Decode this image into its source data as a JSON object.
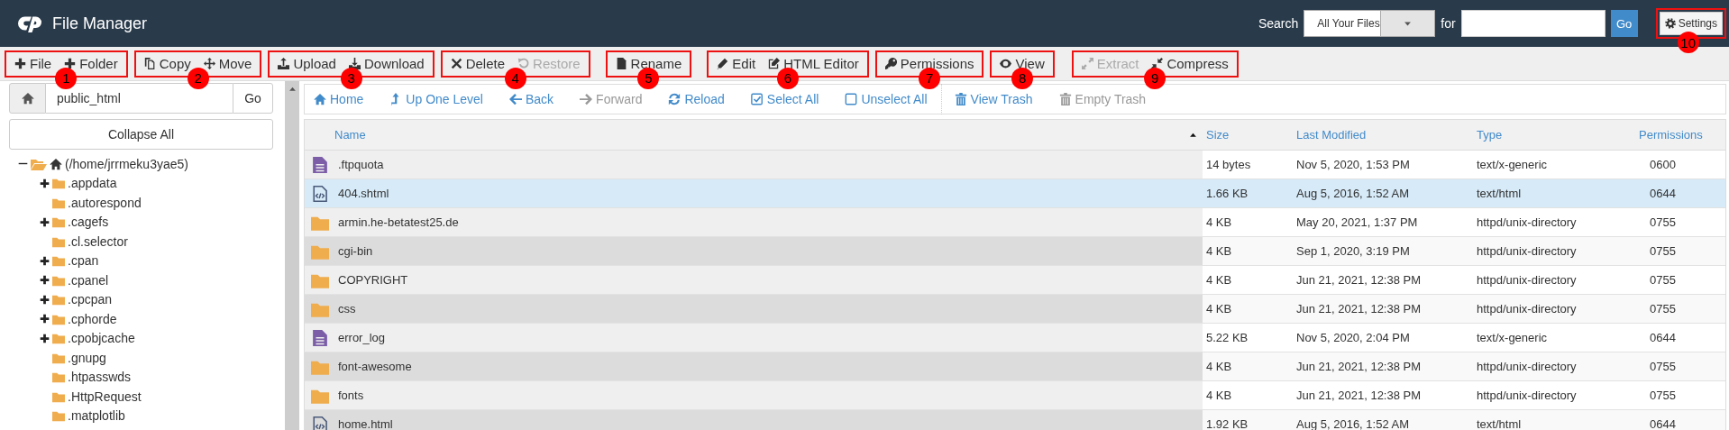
{
  "header": {
    "title": "File Manager",
    "search_label": "Search",
    "scope": "All Your Files",
    "for_label": "for",
    "go": "Go",
    "settings": {
      "label": "Settings",
      "callout": "10"
    }
  },
  "toolbar": [
    {
      "callout": "1",
      "buttons": [
        {
          "label": "File",
          "disabled": false
        },
        {
          "label": "Folder",
          "disabled": false
        }
      ]
    },
    {
      "callout": "2",
      "buttons": [
        {
          "label": "Copy",
          "disabled": false
        },
        {
          "label": "Move",
          "disabled": false
        }
      ]
    },
    {
      "callout": "3",
      "buttons": [
        {
          "label": "Upload",
          "disabled": false
        },
        {
          "label": "Download",
          "disabled": false
        }
      ]
    },
    {
      "callout": "4",
      "buttons": [
        {
          "label": "Delete",
          "disabled": false
        },
        {
          "label": "Restore",
          "disabled": true
        }
      ]
    },
    {
      "callout": "5",
      "buttons": [
        {
          "label": "Rename",
          "disabled": false
        }
      ]
    },
    {
      "callout": "6",
      "buttons": [
        {
          "label": "Edit",
          "disabled": false
        },
        {
          "label": "HTML Editor",
          "disabled": false
        }
      ]
    },
    {
      "callout": "7",
      "buttons": [
        {
          "label": "Permissions",
          "disabled": false
        }
      ]
    },
    {
      "callout": "8",
      "buttons": [
        {
          "label": "View",
          "disabled": false
        }
      ]
    },
    {
      "callout": "9",
      "buttons": [
        {
          "label": "Extract",
          "disabled": true
        },
        {
          "label": "Compress",
          "disabled": false
        }
      ]
    }
  ],
  "sidebar": {
    "path": "public_html",
    "go": "Go",
    "collapse": "Collapse All",
    "tree": {
      "label": "(/home/jrrmeku3yae5)",
      "kind": "branch",
      "expanded": true,
      "children": [
        {
          "label": ".appdata",
          "kind": "branch",
          "expanded": false
        },
        {
          "label": ".autorespond",
          "kind": "leaf"
        },
        {
          "label": ".cagefs",
          "kind": "branch",
          "expanded": false
        },
        {
          "label": ".cl.selector",
          "kind": "leaf"
        },
        {
          "label": ".cpan",
          "kind": "branch",
          "expanded": false
        },
        {
          "label": ".cpanel",
          "kind": "branch",
          "expanded": false
        },
        {
          "label": ".cpcpan",
          "kind": "branch",
          "expanded": false
        },
        {
          "label": ".cphorde",
          "kind": "branch",
          "expanded": false
        },
        {
          "label": ".cpobjcache",
          "kind": "branch",
          "expanded": false
        },
        {
          "label": ".gnupg",
          "kind": "leaf"
        },
        {
          "label": ".htpasswds",
          "kind": "leaf"
        },
        {
          "label": ".HttpRequest",
          "kind": "leaf"
        },
        {
          "label": ".matplotlib",
          "kind": "leaf"
        }
      ]
    }
  },
  "nav": [
    {
      "label": "Home",
      "disabled": false
    },
    {
      "label": "Up One Level",
      "disabled": false
    },
    {
      "label": "Back",
      "disabled": false
    },
    {
      "label": "Forward",
      "disabled": true
    },
    {
      "label": "Reload",
      "disabled": false
    },
    {
      "label": "Select All",
      "disabled": false
    },
    {
      "label": "Unselect All",
      "disabled": false
    },
    {
      "label": "View Trash",
      "disabled": false
    },
    {
      "label": "Empty Trash",
      "disabled": true
    }
  ],
  "table": {
    "columns": [
      {
        "label": "Name",
        "sorted": true
      },
      {
        "label": "Size",
        "sorted": false
      },
      {
        "label": "Last Modified",
        "sorted": false
      },
      {
        "label": "Type",
        "sorted": false
      },
      {
        "label": "Permissions",
        "sorted": false
      }
    ],
    "rows": [
      {
        "kind": "text",
        "name": ".ftpquota",
        "size": "14 bytes",
        "modified": "Nov 5, 2020, 1:53 PM",
        "type": "text/x-generic",
        "permissions": "0600",
        "selected": false
      },
      {
        "kind": "code",
        "name": "404.shtml",
        "size": "1.66 KB",
        "modified": "Aug 5, 2016, 1:52 AM",
        "type": "text/html",
        "permissions": "0644",
        "selected": true
      },
      {
        "kind": "folder",
        "name": "armin.he-betatest25.de",
        "size": "4 KB",
        "modified": "May 20, 2021, 1:37 PM",
        "type": "httpd/unix-directory",
        "permissions": "0755",
        "selected": false
      },
      {
        "kind": "folder",
        "name": "cgi-bin",
        "size": "4 KB",
        "modified": "Sep 1, 2020, 3:19 PM",
        "type": "httpd/unix-directory",
        "permissions": "0755",
        "selected": false
      },
      {
        "kind": "folder",
        "name": "COPYRIGHT",
        "size": "4 KB",
        "modified": "Jun 21, 2021, 12:38 PM",
        "type": "httpd/unix-directory",
        "permissions": "0755",
        "selected": false
      },
      {
        "kind": "folder",
        "name": "css",
        "size": "4 KB",
        "modified": "Jun 21, 2021, 12:38 PM",
        "type": "httpd/unix-directory",
        "permissions": "0755",
        "selected": false
      },
      {
        "kind": "text",
        "name": "error_log",
        "size": "5.22 KB",
        "modified": "Nov 5, 2020, 2:04 PM",
        "type": "text/x-generic",
        "permissions": "0644",
        "selected": false
      },
      {
        "kind": "folder",
        "name": "font-awesome",
        "size": "4 KB",
        "modified": "Jun 21, 2021, 12:38 PM",
        "type": "httpd/unix-directory",
        "permissions": "0755",
        "selected": false
      },
      {
        "kind": "folder",
        "name": "fonts",
        "size": "4 KB",
        "modified": "Jun 21, 2021, 12:38 PM",
        "type": "httpd/unix-directory",
        "permissions": "0755",
        "selected": false
      },
      {
        "kind": "code",
        "name": "home.html",
        "size": "1.92 KB",
        "modified": "Aug 5, 2016, 1:52 AM",
        "type": "text/html",
        "permissions": "0644",
        "selected": false
      }
    ]
  }
}
